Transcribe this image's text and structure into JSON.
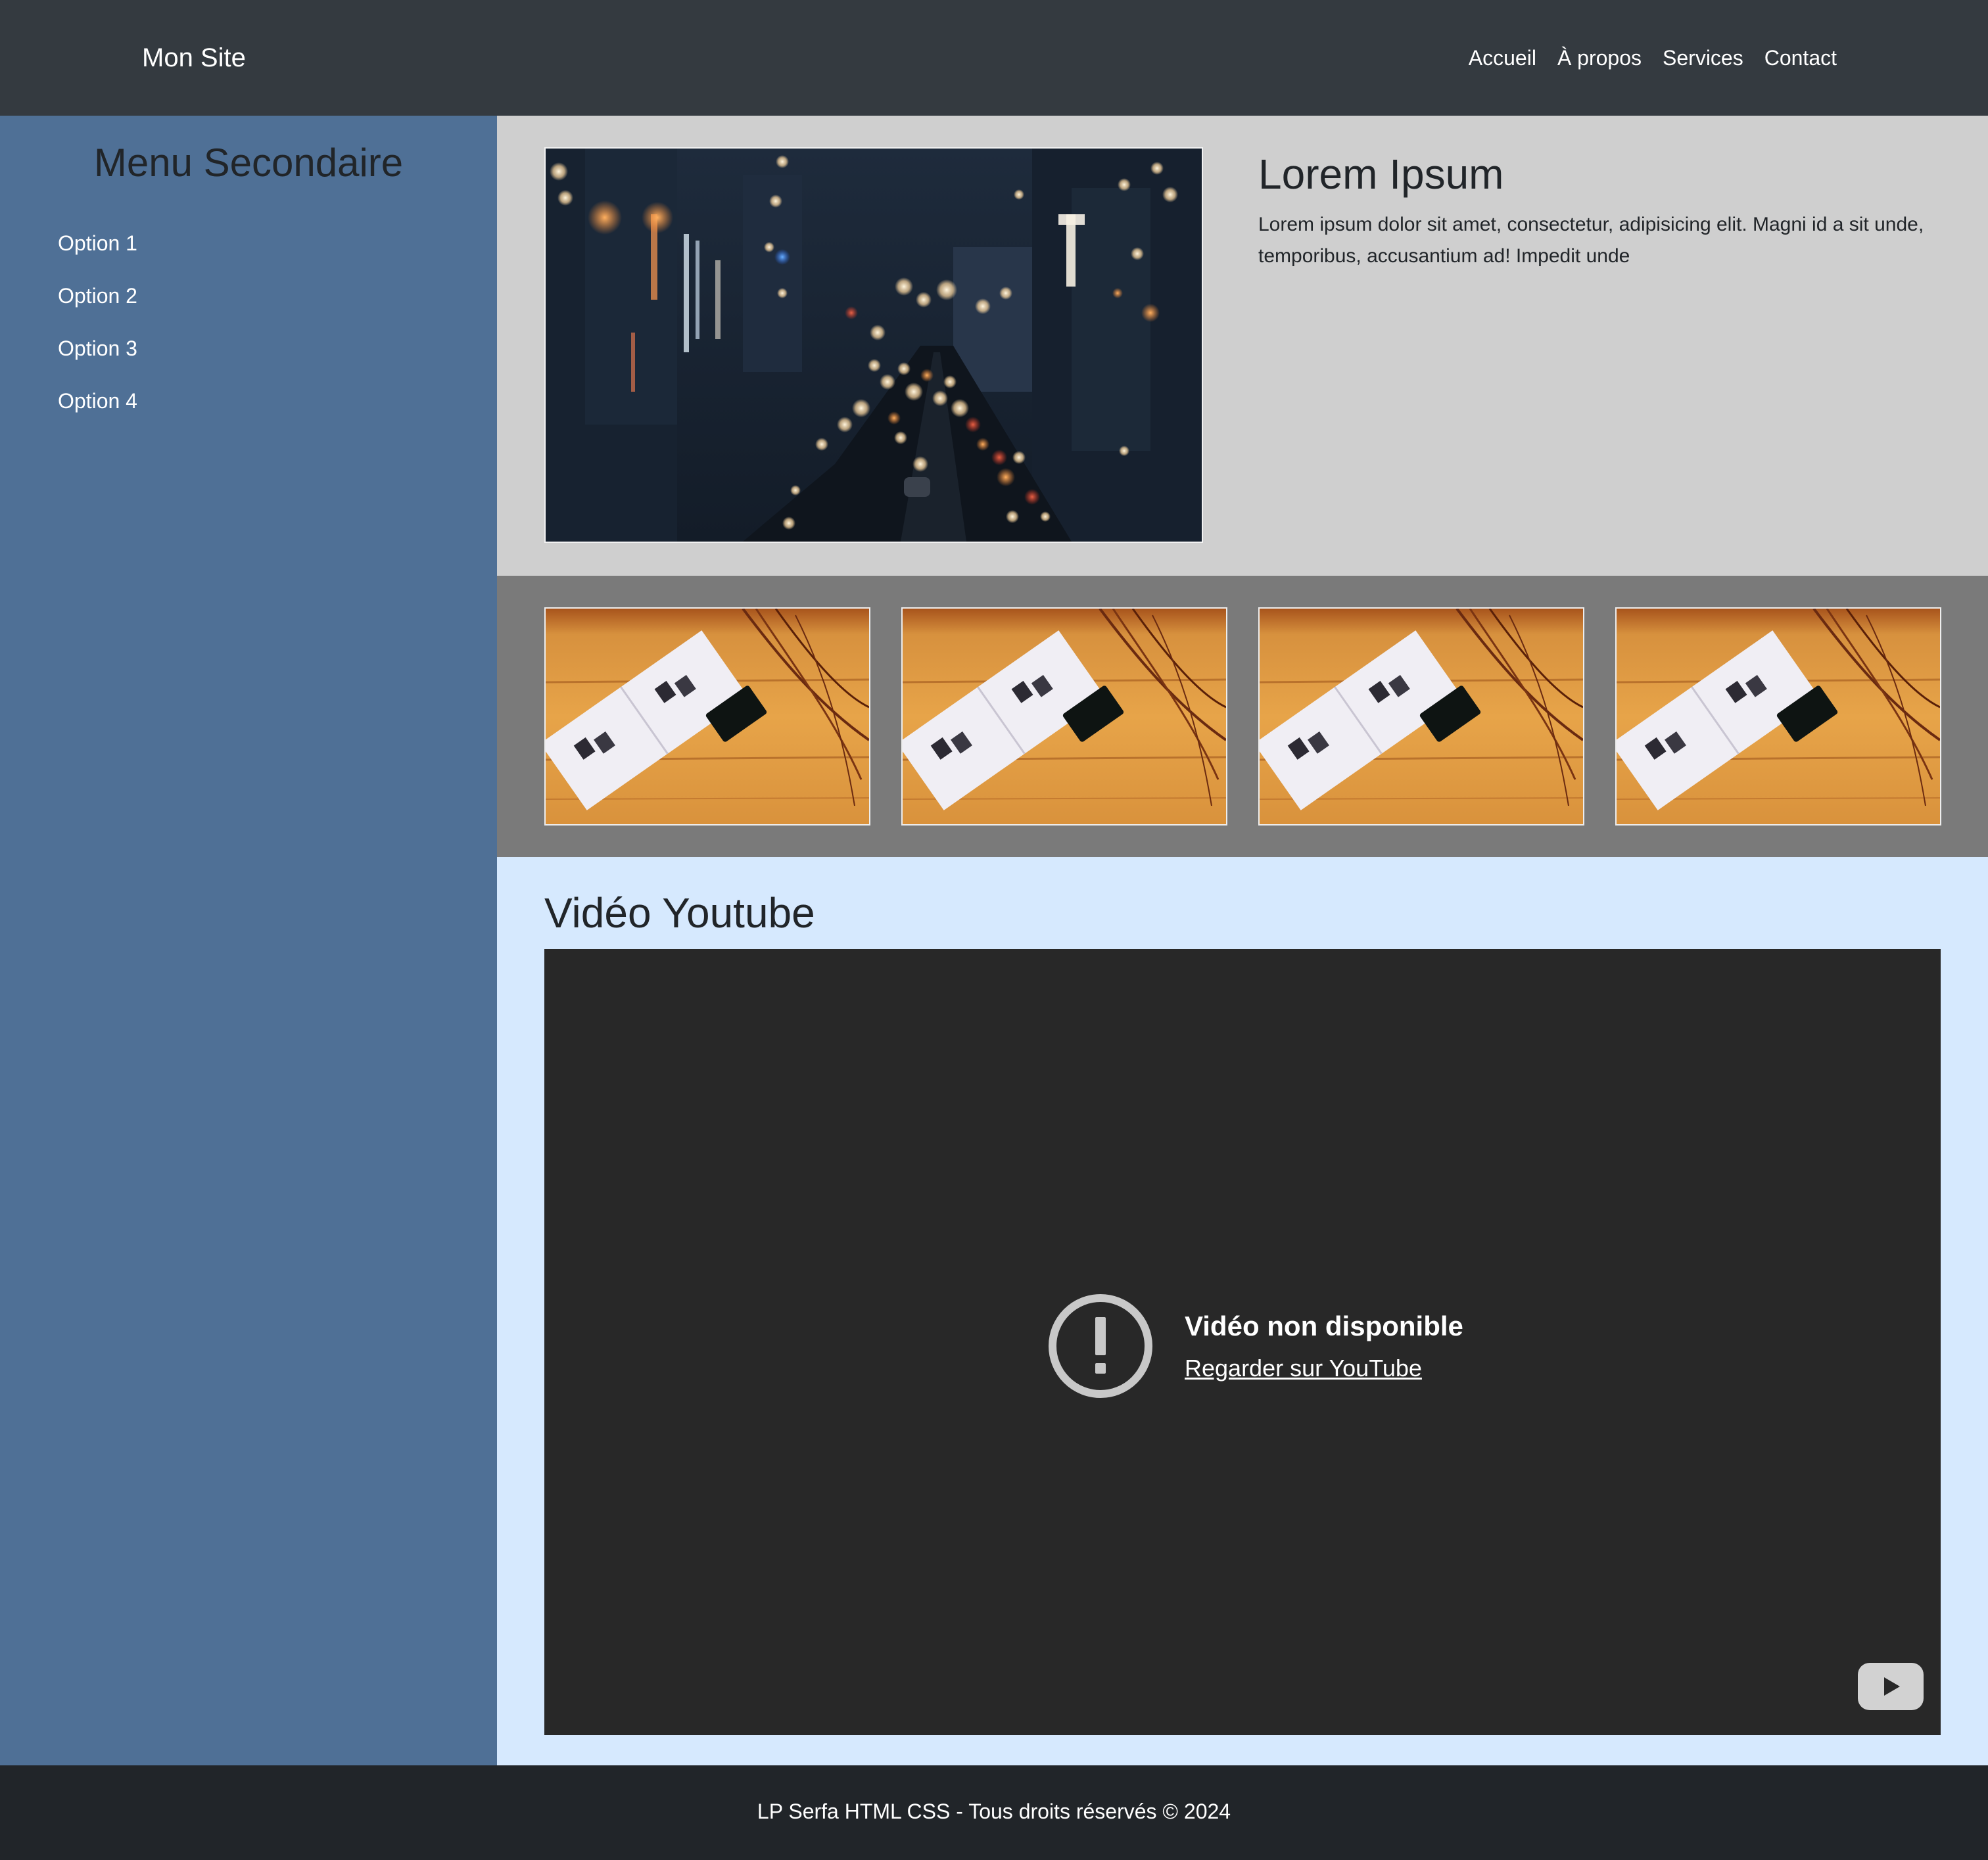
{
  "header": {
    "brand": "Mon Site",
    "nav": [
      "Accueil",
      "À propos",
      "Services",
      "Contact"
    ]
  },
  "sidebar": {
    "title": "Menu Secondaire",
    "items": [
      "Option 1",
      "Option 2",
      "Option 3",
      "Option 4"
    ]
  },
  "feature": {
    "image_icon": "city-night-photo",
    "title": "Lorem Ipsum",
    "text": "Lorem ipsum dolor sit amet, consectetur, adipisicing elit. Magni id a sit unde, temporibus, accusantium ad! Impedit unde"
  },
  "gallery": {
    "image_icon": "book-on-wooden-table-photo",
    "count": 4
  },
  "video": {
    "title": "Vidéo Youtube",
    "error_title": "Vidéo non disponible",
    "error_link": "Regarder sur YouTube",
    "error_icon": "alert-circle-icon",
    "player_icon": "youtube-logo-icon"
  },
  "footer": {
    "text": "LP Serfa HTML CSS - Tous droits réservés © 2024"
  },
  "colors": {
    "header_bg": "#343a40",
    "sidebar_bg": "#4f7096",
    "feature_bg": "#cfcfcf",
    "gallery_bg": "#7a7a7a",
    "video_section_bg": "#d6e9fe",
    "video_player_bg": "#282828",
    "footer_bg": "#212529",
    "text_dark": "#212529",
    "text_light": "#ffffff"
  }
}
